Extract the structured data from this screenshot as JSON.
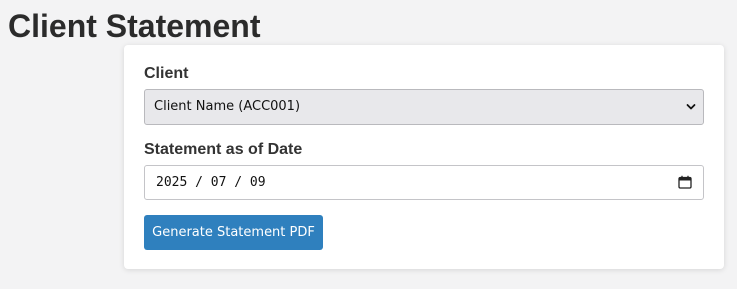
{
  "page": {
    "title": "Client Statement"
  },
  "form": {
    "client_label": "Client",
    "client_selected": "Client Name (ACC001)",
    "date_label": "Statement as of Date",
    "date_value": "2025 / 07 / 09",
    "generate_button_label": "Generate Statement PDF"
  },
  "icons": {
    "select_toggle": "chevron-down-icon",
    "date_picker": "calendar-icon"
  },
  "colors": {
    "primary_button": "#2f80be",
    "select_background": "#e8e8eb",
    "page_background": "#f3f3f4"
  }
}
